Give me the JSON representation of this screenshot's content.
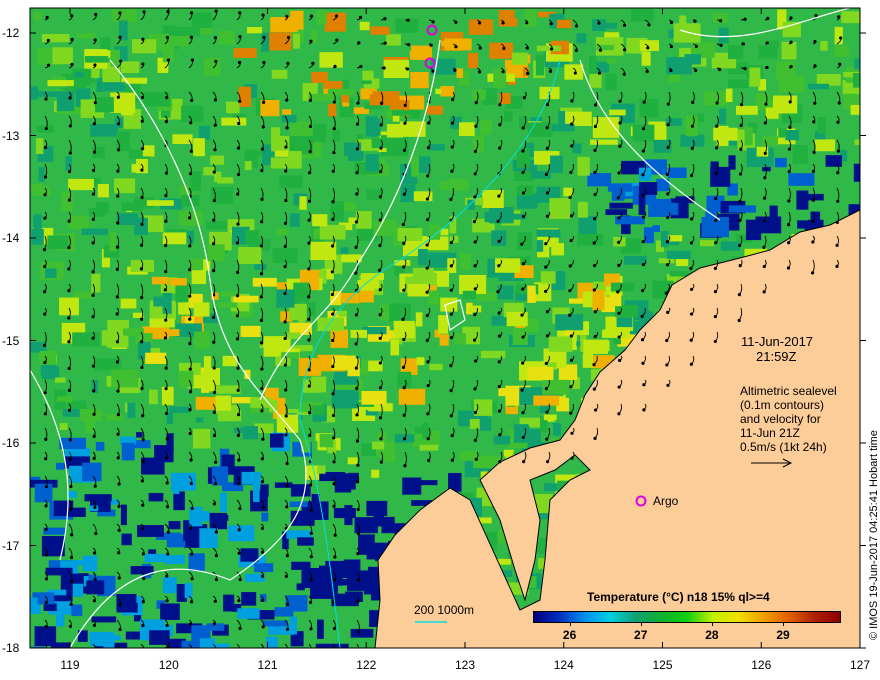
{
  "map": {
    "lon_ticks": [
      "119",
      "120",
      "121",
      "122",
      "123",
      "124",
      "125",
      "126",
      "127"
    ],
    "lat_ticks": [
      "-12",
      "-13",
      "-14",
      "-15",
      "-16",
      "-17",
      "-18"
    ],
    "lon_range": [
      118.6,
      127
    ],
    "lat_range": [
      -11.75,
      -18
    ]
  },
  "annotation": {
    "date": "11-Jun-2017",
    "time": "21:59Z",
    "note_lines": [
      "Altimetric sealevel",
      "(0.1m contours)",
      "and velocity for",
      "11-Jun 21Z",
      "0.5m/s (1kt 24h)"
    ],
    "argo_label": "Argo",
    "scale_label": "200  1000m"
  },
  "legend": {
    "title": "Temperature (°C) n18 15% ql>=4",
    "ticks": [
      "26",
      "27",
      "28",
      "29"
    ],
    "range": [
      25.5,
      29.8
    ]
  },
  "credit": "© IMOS 19-Jun-2017 04:25:41 Hobart time",
  "colors": {
    "land": "#fccc99",
    "argo": "#e000e0",
    "contour": "#ffffff",
    "isobath": "#00e0e0"
  }
}
